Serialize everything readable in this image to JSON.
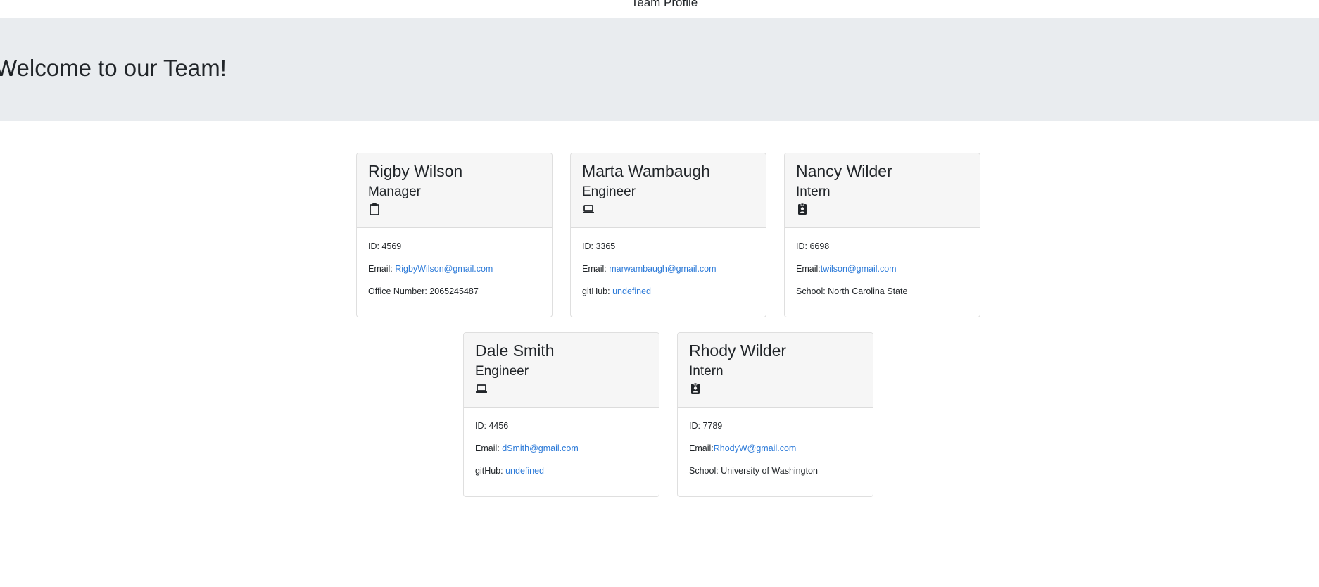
{
  "header": {
    "page_title": "Team Profile",
    "welcome": "Welcome to our Team!"
  },
  "colors": {
    "jumbotron_bg": "#e9ecef",
    "card_header_bg": "#f6f6f6",
    "link": "#2c7ad8",
    "text": "#212529"
  },
  "members": [
    {
      "name": "Rigby Wilson",
      "role": "Manager",
      "icon": "clipboard-icon",
      "id_label": "ID: 4569",
      "email_label": "Email: ",
      "email": "RigbyWilson@gmail.com",
      "extra_label": "Office Number: 2065245487",
      "extra_link": ""
    },
    {
      "name": "Marta Wambaugh",
      "role": "Engineer",
      "icon": "laptop-icon",
      "id_label": "ID: 3365",
      "email_label": "Email: ",
      "email": "marwambaugh@gmail.com",
      "extra_label": "gitHub: ",
      "extra_link": "undefined"
    },
    {
      "name": "Nancy Wilder",
      "role": "Intern",
      "icon": "id-badge-icon",
      "id_label": "ID: 6698",
      "email_label": "Email:",
      "email": "twilson@gmail.com",
      "extra_label": "School: North Carolina State",
      "extra_link": ""
    },
    {
      "name": "Dale Smith",
      "role": "Engineer",
      "icon": "laptop-icon",
      "id_label": "ID: 4456",
      "email_label": "Email: ",
      "email": "dSmith@gmail.com",
      "extra_label": "gitHub: ",
      "extra_link": "undefined"
    },
    {
      "name": "Rhody Wilder",
      "role": "Intern",
      "icon": "id-badge-icon",
      "id_label": "ID: 7789",
      "email_label": "Email:",
      "email": "RhodyW@gmail.com",
      "extra_label": "School: University of Washington",
      "extra_link": ""
    }
  ]
}
